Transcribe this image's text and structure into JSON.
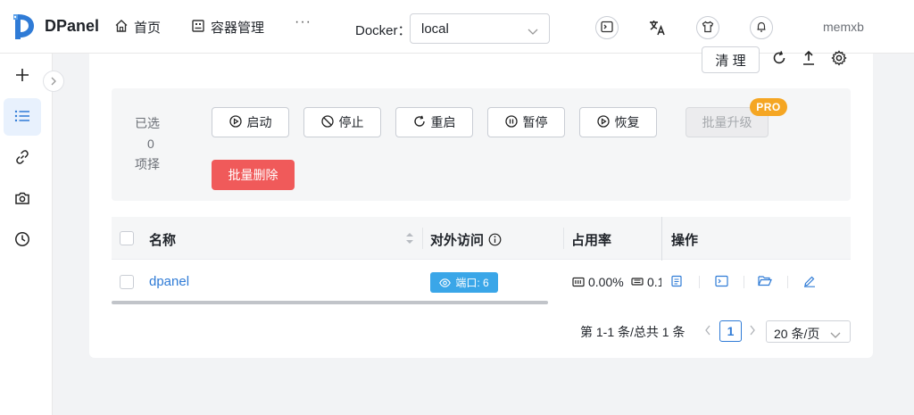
{
  "app": {
    "name": "DPanel",
    "brand_color": "#2f7bd6"
  },
  "header": {
    "nav": [
      {
        "label": "首页",
        "icon": "home-icon"
      },
      {
        "label": "容器管理",
        "icon": "container-icon"
      }
    ],
    "more": "···",
    "docker_label": "Docker：",
    "docker_value": "local",
    "user": "memxb"
  },
  "toolbar": {
    "cleanup_label": "清 理"
  },
  "batch": {
    "selected_prefix": "已选",
    "selected_count": "0",
    "selected_suffix": "项择",
    "actions": [
      {
        "label": "启动",
        "icon": "play-icon"
      },
      {
        "label": "停止",
        "icon": "stop-icon"
      },
      {
        "label": "重启",
        "icon": "restart-icon"
      },
      {
        "label": "暂停",
        "icon": "pause-icon"
      },
      {
        "label": "恢复",
        "icon": "resume-icon"
      }
    ],
    "upgrade_label": "批量升级",
    "pro_badge": "PRO",
    "delete_label": "批量删除",
    "danger_color": "#f05a5a"
  },
  "table": {
    "headers": {
      "name": "名称",
      "access": "对外访问",
      "usage": "占用率",
      "ops": "操作"
    },
    "rows": [
      {
        "name": "dpanel",
        "port_tag": "端口: 6",
        "cpu": "0.00%",
        "mem": "0.1"
      }
    ]
  },
  "pagination": {
    "total_text": "第 1-1 条/总共 1 条",
    "current_page": "1",
    "page_size": "20 条/页"
  }
}
